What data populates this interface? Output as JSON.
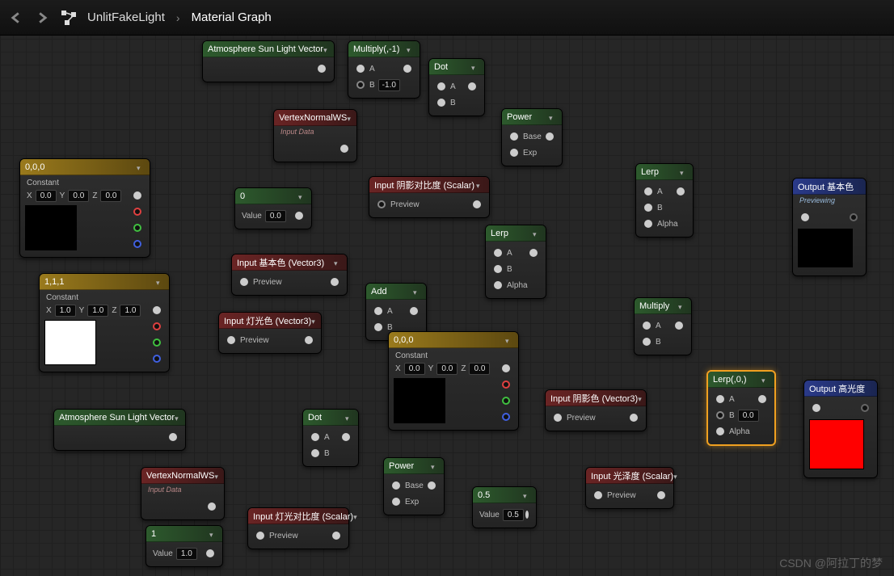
{
  "breadcrumb": {
    "item": "UnlitFakeLight",
    "sub": "Material Graph"
  },
  "nodes": {
    "atm1": {
      "title": "Atmosphere Sun Light Vector"
    },
    "atm2": {
      "title": "Atmosphere Sun Light Vector"
    },
    "mul_neg1": {
      "title": "Multiply(,-1)",
      "a": "A",
      "b": "B",
      "bval": "-1.0"
    },
    "dot1": {
      "title": "Dot",
      "a": "A",
      "b": "B"
    },
    "dot2": {
      "title": "Dot",
      "a": "A",
      "b": "B"
    },
    "vnorm1": {
      "title": "VertexNormalWS",
      "sub": "Input Data"
    },
    "vnorm2": {
      "title": "VertexNormalWS",
      "sub": "Input Data"
    },
    "power1": {
      "title": "Power",
      "base": "Base",
      "exp": "Exp"
    },
    "power2": {
      "title": "Power",
      "base": "Base",
      "exp": "Exp"
    },
    "const000a": {
      "title": "0,0,0",
      "label": "Constant",
      "x": "X",
      "y": "Y",
      "z": "Z",
      "xv": "0.0",
      "yv": "0.0",
      "zv": "0.0"
    },
    "const000b": {
      "title": "0,0,0",
      "label": "Constant",
      "x": "X",
      "y": "Y",
      "z": "Z",
      "xv": "0.0",
      "yv": "0.0",
      "zv": "0.0"
    },
    "const111": {
      "title": "1,1,1",
      "label": "Constant",
      "x": "X",
      "y": "Y",
      "z": "Z",
      "xv": "1.0",
      "yv": "1.0",
      "zv": "1.0"
    },
    "scalar0": {
      "title": "0",
      "label": "Value",
      "val": "0.0"
    },
    "scalar1": {
      "title": "1",
      "label": "Value",
      "val": "1.0"
    },
    "scalar05": {
      "title": "0.5",
      "label": "Value",
      "val": "0.5"
    },
    "in_shadow_contrast": {
      "title": "Input 阴影对比度 (Scalar)",
      "preview": "Preview"
    },
    "in_base": {
      "title": "Input 基本色 (Vector3)",
      "preview": "Preview"
    },
    "in_light": {
      "title": "Input 灯光色 (Vector3)",
      "preview": "Preview"
    },
    "in_shadow": {
      "title": "Input 阴影色 (Vector3)",
      "preview": "Preview"
    },
    "in_light_contrast": {
      "title": "Input 灯光对比度 (Scalar)",
      "preview": "Preview"
    },
    "in_gloss": {
      "title": "Input 光泽度 (Scalar)",
      "preview": "Preview"
    },
    "add": {
      "title": "Add",
      "a": "A",
      "b": "B"
    },
    "lerp1": {
      "title": "Lerp",
      "a": "A",
      "b": "B",
      "alpha": "Alpha"
    },
    "lerp2": {
      "title": "Lerp",
      "a": "A",
      "b": "B",
      "alpha": "Alpha"
    },
    "lerp0": {
      "title": "Lerp(,0,)",
      "a": "A",
      "b": "B",
      "bval": "0.0",
      "alpha": "Alpha"
    },
    "multiply": {
      "title": "Multiply",
      "a": "A",
      "b": "B"
    },
    "out_base": {
      "title": "Output 基本色",
      "sub": "Previewing"
    },
    "out_spec": {
      "title": "Output 高光度"
    }
  },
  "watermark": "CSDN @阿拉丁的梦"
}
